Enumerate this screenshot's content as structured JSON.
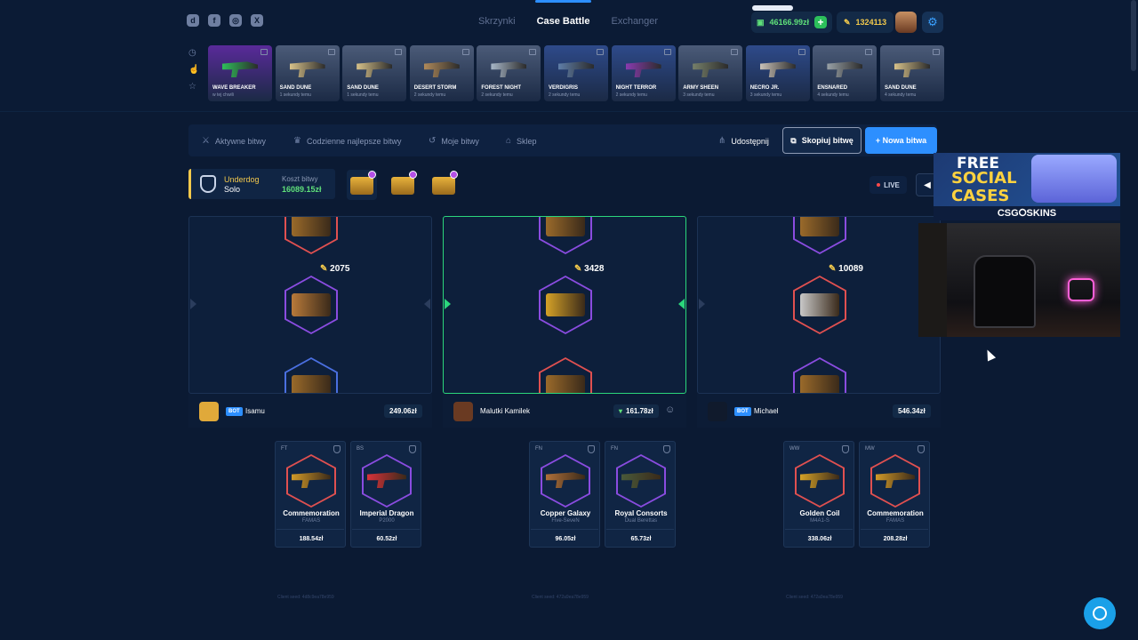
{
  "header": {
    "nav": [
      "Skrzynki",
      "Case Battle",
      "Exchanger"
    ],
    "balance": "46166.99zł",
    "points": "1324113",
    "socials": [
      "discord-icon",
      "facebook-icon",
      "instagram-icon",
      "x-icon"
    ]
  },
  "drops": [
    {
      "name": "WAVE BREAKER",
      "time": "w tej chwili",
      "color": "#5a2a9a",
      "gun": "#2fbf5a"
    },
    {
      "name": "SAND DUNE",
      "time": "1 sekundy temu",
      "color": "#4b5b78",
      "gun": "#d8c28a"
    },
    {
      "name": "SAND DUNE",
      "time": "1 sekundy temu",
      "color": "#4b5b78",
      "gun": "#d8c28a"
    },
    {
      "name": "DESERT STORM",
      "time": "2 sekundy temu",
      "color": "#4b5b78",
      "gun": "#b08a5a"
    },
    {
      "name": "FOREST NIGHT",
      "time": "2 sekundy temu",
      "color": "#4b5b78",
      "gun": "#a9b8c9"
    },
    {
      "name": "VERDIGRIS",
      "time": "2 sekundy temu",
      "color": "#2e4a8a",
      "gun": "#5f7ea8"
    },
    {
      "name": "NIGHT TERROR",
      "time": "2 sekundy temu",
      "color": "#2e4a8a",
      "gun": "#8a3bb0"
    },
    {
      "name": "ARMY SHEEN",
      "time": "3 sekundy temu",
      "color": "#4b5b78",
      "gun": "#77806a"
    },
    {
      "name": "NECRO JR.",
      "time": "3 sekundy temu",
      "color": "#2e4a8a",
      "gun": "#c9c2b8"
    },
    {
      "name": "ENSNARED",
      "time": "4 sekundy temu",
      "color": "#4b5b78",
      "gun": "#9aa2a8"
    },
    {
      "name": "SAND DUNE",
      "time": "4 sekundy temu",
      "color": "#4b5b78",
      "gun": "#d8c28a"
    }
  ],
  "tabs": {
    "active": "Aktywne bitwy",
    "best": "Codzienne najlepsze bitwy",
    "mine": "Moje bitwy",
    "shop": "Sklep",
    "share": "Udostępnij",
    "copy": "Skopiuj bitwę",
    "new": "+ Nowa bitwa"
  },
  "battle": {
    "mode_title": "Underdog",
    "mode_sub": "Solo",
    "cost_label": "Koszt bitwy",
    "cost": "16089.15zł",
    "live": "LIVE"
  },
  "players": [
    {
      "name": "Isamu",
      "bot": "BOT",
      "value": "249.06zł",
      "points": "2075",
      "seed": "Client seed: 4d8c9ea78e959",
      "items": [
        {
          "cond": "FT",
          "name": "Commemoration",
          "type": "FAMAS",
          "price": "188.54zł",
          "rarity": "#e05050",
          "gun": "#d29a28"
        },
        {
          "cond": "BS",
          "name": "Imperial Dragon",
          "type": "P2000",
          "price": "60.52zł",
          "rarity": "#8a4ce0",
          "gun": "#d8323a"
        }
      ]
    },
    {
      "name": "Malutki Kamilek",
      "bot": "",
      "value": "161.78zł",
      "points": "3428",
      "seed": "Client seed: 472a9ea78e959",
      "items": [
        {
          "cond": "FN",
          "name": "Copper Galaxy",
          "type": "Five-SeveN",
          "price": "96.05zł",
          "rarity": "#8a4ce0",
          "gun": "#b0703a"
        },
        {
          "cond": "FN",
          "name": "Royal Consorts",
          "type": "Dual Berettas",
          "price": "65.73zł",
          "rarity": "#8a4ce0",
          "gun": "#4a5a3a"
        }
      ]
    },
    {
      "name": "Michael",
      "bot": "BOT",
      "value": "546.34zł",
      "points": "10089",
      "seed": "Client seed: 472a9ea78e959",
      "items": [
        {
          "cond": "WW",
          "name": "Golden Coil",
          "type": "M4A1-S",
          "price": "338.06zł",
          "rarity": "#e05050",
          "gun": "#d5a227"
        },
        {
          "cond": "MW",
          "name": "Commemoration",
          "type": "FAMAS",
          "price": "208.28zł",
          "rarity": "#e05050",
          "gun": "#d29a28"
        }
      ]
    }
  ],
  "promo": {
    "line1": "FREE",
    "line2": "SOCIAL",
    "line3": "CASES",
    "brand": "CSG⭘SKINS"
  }
}
